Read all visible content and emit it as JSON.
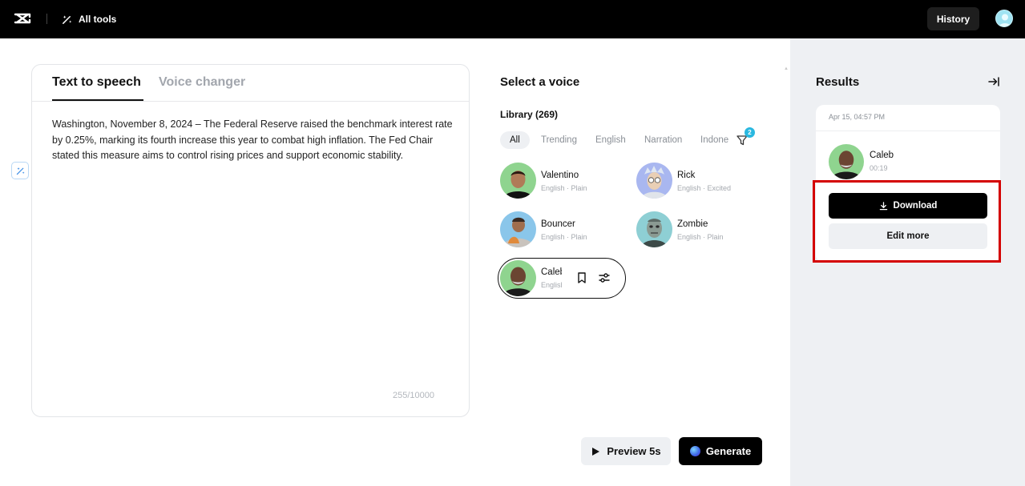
{
  "topbar": {
    "logo_icon": "capcut-logo-icon",
    "all_tools_label": "All tools",
    "history_label": "History"
  },
  "editor": {
    "tabs": [
      {
        "label": "Text to speech",
        "active": true
      },
      {
        "label": "Voice changer",
        "active": false
      }
    ],
    "text": "Washington, November 8, 2024 – The Federal Reserve raised the benchmark interest rate by 0.25%, marking its fourth increase this year to combat high inflation. The Fed Chair stated this measure aims to control rising prices and support economic stability.",
    "char_count": "255/10000"
  },
  "voice_panel": {
    "title": "Select a voice",
    "library_label": "Library (269)",
    "filters": [
      "All",
      "Trending",
      "English",
      "Narration",
      "Indone"
    ],
    "active_filter": "All",
    "filter_badge": "2",
    "voices": [
      {
        "name": "Valentino",
        "meta": "English · Plain"
      },
      {
        "name": "Rick",
        "meta": "English · Excited"
      },
      {
        "name": "Bouncer",
        "meta": "English · Plain"
      },
      {
        "name": "Zombie",
        "meta": "English · Plain"
      }
    ],
    "selected_voice": {
      "name": "Caleb",
      "meta": "English · Plain"
    }
  },
  "actions": {
    "preview_label": "Preview 5s",
    "generate_label": "Generate"
  },
  "results": {
    "title": "Results",
    "card": {
      "date": "Apr 15, 04:57 PM",
      "name": "Caleb",
      "duration": "00:19",
      "download_label": "Download",
      "edit_more_label": "Edit more"
    }
  },
  "colors": {
    "accent_badge": "#2ab8e0",
    "highlight": "#d40000",
    "panel_bg": "#eef0f3"
  }
}
